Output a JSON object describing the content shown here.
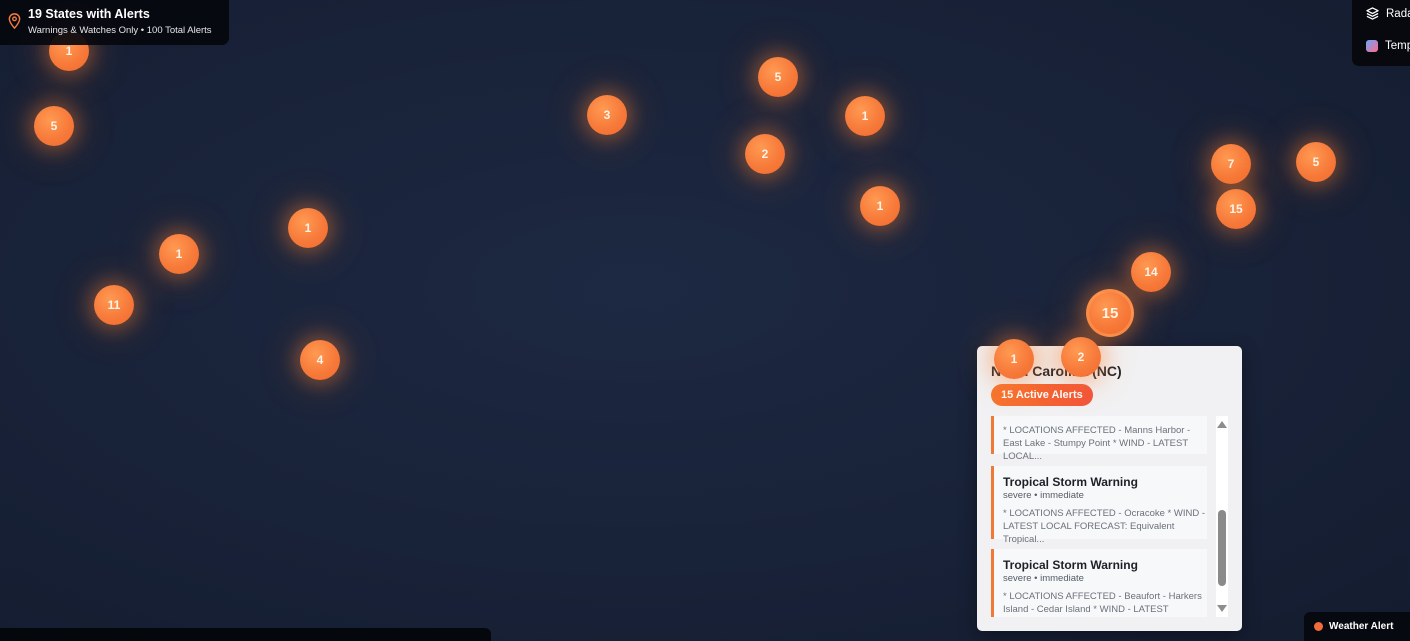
{
  "summary": {
    "title": "19 States with Alerts",
    "subtitle": "Warnings & Watches Only • 100 Total Alerts",
    "icon": "map-pin-icon"
  },
  "layers": {
    "items": [
      {
        "label": "Radar",
        "icon": "layers-icon"
      },
      {
        "label": "Temperature",
        "icon": "temperature-swatch"
      }
    ]
  },
  "legend": {
    "label": "Weather Alert",
    "color": "#f26b3a"
  },
  "markers": [
    "1",
    "5",
    "3",
    "5",
    "1",
    "2",
    "1",
    "1",
    "1",
    "11",
    "4",
    "7",
    "5",
    "15",
    "14",
    "15",
    "1",
    "2"
  ],
  "popup": {
    "state": "North Carolina (NC)",
    "badge": "15 Active Alerts",
    "alerts": [
      {
        "title": "",
        "meta": "",
        "description": "* LOCATIONS AFFECTED - Manns Harbor - East Lake - Stumpy Point * WIND - LATEST LOCAL..."
      },
      {
        "title": "Tropical Storm Warning",
        "meta": "severe • immediate",
        "description": "* LOCATIONS AFFECTED - Ocracoke * WIND - LATEST LOCAL FORECAST: Equivalent Tropical..."
      },
      {
        "title": "Tropical Storm Warning",
        "meta": "severe • immediate",
        "description": "* LOCATIONS AFFECTED - Beaufort - Harkers Island - Cedar Island * WIND - LATEST LOCAL..."
      }
    ]
  },
  "colors": {
    "background": "#19233a",
    "marker": "#f77a3a",
    "accent": "#ee7a35"
  }
}
